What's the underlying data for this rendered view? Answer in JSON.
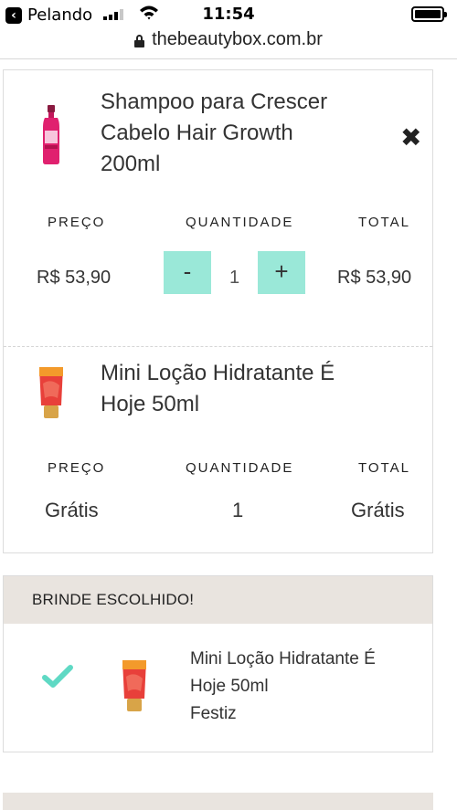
{
  "status_bar": {
    "back_app": "Pelando",
    "time": "11:54"
  },
  "browser": {
    "url": "thebeautybox.com.br"
  },
  "cart": {
    "items": [
      {
        "name_lines": [
          "Shampoo para Crescer",
          "Cabelo Hair Growth",
          "200ml"
        ],
        "labels": {
          "price": "PREÇO",
          "quantity": "QUANTIDADE",
          "total": "TOTAL"
        },
        "price": "R$ 53,90",
        "quantity": "1",
        "total": "R$ 53,90",
        "minus": "-",
        "plus": "+",
        "remove": "✖",
        "thumb_color": "#e0216f"
      },
      {
        "name_lines": [
          "Mini Loção Hidratante É",
          "Hoje 50ml"
        ],
        "labels": {
          "price": "PREÇO",
          "quantity": "QUANTIDADE",
          "total": "TOTAL"
        },
        "price": "Grátis",
        "quantity": "1",
        "total": "Grátis",
        "thumb_color": "#e8403a"
      }
    ]
  },
  "gift": {
    "header": "BRINDE ESCOLHIDO!",
    "lines": [
      "Mini Loção Hidratante É",
      "Hoje 50ml",
      "Festiz"
    ],
    "check_color": "#5fd9c4"
  }
}
